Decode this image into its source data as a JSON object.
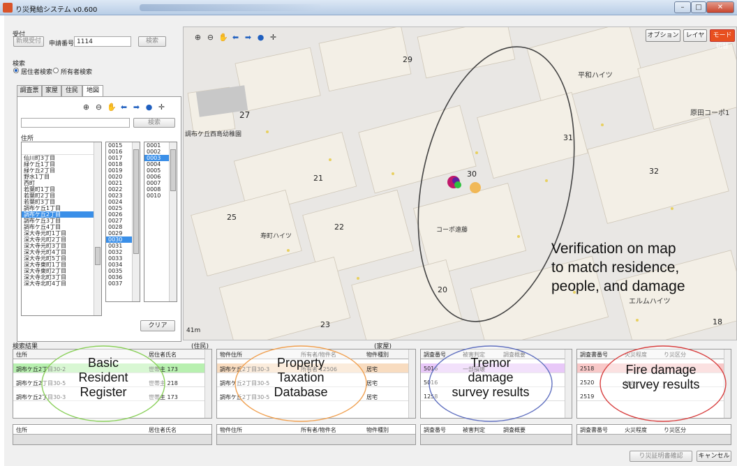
{
  "window": {
    "title": "り災発給システム v0.600",
    "min": "–",
    "max": "□",
    "close": "✕"
  },
  "reception": {
    "heading": "受付",
    "new_button": "新規受付",
    "app_no_label": "申請番号",
    "app_no_value": "1114",
    "search_button": "検索"
  },
  "search": {
    "heading": "検索",
    "radio_resident": "居住者検索",
    "radio_owner": "所有者検索",
    "tabs": [
      "調査票",
      "家屋",
      "住民",
      "地図"
    ],
    "selected_tab": 3,
    "field_value": "",
    "search_button": "検索",
    "address_label": "住所",
    "address_list": [
      "仙川町3丁目",
      "緑ケ丘1丁目",
      "緑ケ丘2丁目",
      "野水1丁目",
      "西町",
      "若葉町1丁目",
      "若葉町2丁目",
      "若葉町3丁目",
      "調布ケ丘1丁目",
      "調布ケ丘2丁目",
      "調布ケ丘3丁目",
      "調布ケ丘4丁目",
      "深大寺元町1丁目",
      "深大寺元町2丁目",
      "深大寺元町3丁目",
      "深大寺元町4丁目",
      "深大寺元町5丁目",
      "深大寺東町1丁目",
      "深大寺東町2丁目",
      "深大寺北町3丁目",
      "深大寺北町4丁目"
    ],
    "address_selected": 9,
    "block_list": [
      "0015",
      "0016",
      "0017",
      "0018",
      "0019",
      "0020",
      "0021",
      "0022",
      "0023",
      "0024",
      "0025",
      "0026",
      "0027",
      "0028",
      "0029",
      "0030",
      "0031",
      "0032",
      "0033",
      "0034",
      "0035",
      "0036",
      "0037"
    ],
    "block_selected": 15,
    "lot_list": [
      "0001",
      "0002",
      "0003",
      "0004",
      "0005",
      "0006",
      "0007",
      "0008",
      "0010"
    ],
    "lot_selected": 2,
    "clear_button": "クリア"
  },
  "map": {
    "toolbar_icons": [
      "zoom-in",
      "zoom-out",
      "pan",
      "back",
      "forward",
      "globe",
      "crosshair"
    ],
    "option_button": "オプション",
    "layer_button": "レイヤ",
    "mode_button": "モード切替",
    "labels": {
      "area29": "29",
      "area27": "27",
      "area31": "31",
      "area32": "32",
      "area30": "30",
      "area21": "21",
      "area22": "22",
      "area25": "25",
      "area20": "20",
      "area23": "23",
      "area18": "18",
      "heiwa": "平和ハイツ",
      "harada": "原田コーポ1",
      "chofu_school": "調布ケ丘西島幼稚園",
      "kotobuki": "寿町ハイツ",
      "coop": "コーポ遠藤",
      "elm": "エルムハイツ",
      "scale": "41m"
    },
    "annotation": [
      "Verification on map",
      "to match residence,",
      "people, and damage"
    ]
  },
  "results": {
    "label_search": "検索結果",
    "label_resident": "(住民)",
    "label_house": "(家屋)",
    "label_fire": "",
    "grid_resident": {
      "headers": [
        "住所",
        "居住者氏名"
      ],
      "rows": [
        [
          "調布ケ丘2丁目30-2",
          "世帯主 173"
        ],
        [
          "調布ケ丘2丁目30-5",
          "世帯主 218"
        ],
        [
          "調布ケ丘2丁目30-3",
          "世帯主 173"
        ]
      ]
    },
    "grid_property": {
      "headers": [
        "物件住所",
        "所有者/物件名",
        "物件種別"
      ],
      "rows": [
        [
          "調布ケ丘2丁目30-3",
          "所有者 12506",
          "居宅"
        ],
        [
          "調布ケ丘2丁目30-5",
          "",
          "居宅"
        ],
        [
          "調布ケ丘2丁目30-5",
          "",
          "居宅"
        ]
      ]
    },
    "grid_tremor": {
      "headers": [
        "調査番号",
        "被害判定",
        "調査概要"
      ],
      "rows": [
        [
          "5016",
          "一部損壊",
          ""
        ],
        [
          "5016",
          "",
          ""
        ],
        [
          "1258",
          "",
          ""
        ]
      ]
    },
    "grid_fire": {
      "headers": [
        "調査書番号",
        "火災程度",
        "り災区分"
      ],
      "rows": [
        [
          "2518",
          "",
          ""
        ],
        [
          "2520",
          "ほか",
          ""
        ],
        [
          "2519",
          "",
          ""
        ]
      ]
    },
    "overlays": {
      "resident": [
        "Basic",
        "Resident",
        "Register"
      ],
      "property": [
        "Property",
        "Taxation",
        "Database"
      ],
      "tremor": [
        "Tremor",
        "damage",
        "survey results"
      ],
      "fire": [
        "Fire damage",
        "survey results"
      ]
    }
  },
  "selection": {
    "h_resident_addr": "住所",
    "h_resident_name": "居住者氏名",
    "h_prop_addr": "物件住所",
    "h_prop_owner": "所有者/物件名",
    "h_prop_type": "物件種別",
    "h_tremor_no": "調査番号",
    "h_tremor_judge": "被害判定",
    "h_tremor_sum": "調査概要",
    "h_fire_no": "調査書番号",
    "h_fire_deg": "火災程度",
    "h_fire_cat": "り災区分"
  },
  "footer": {
    "confirm_button": "り災証明書確認",
    "cancel_button": "キャンセル"
  },
  "colors": {
    "accent": "#e8501f",
    "selection": "#3a8fe8",
    "resident_ellipse": "#8ad05a",
    "property_ellipse": "#f0a050",
    "tremor_ellipse": "#6070c0",
    "fire_ellipse": "#d84040"
  }
}
